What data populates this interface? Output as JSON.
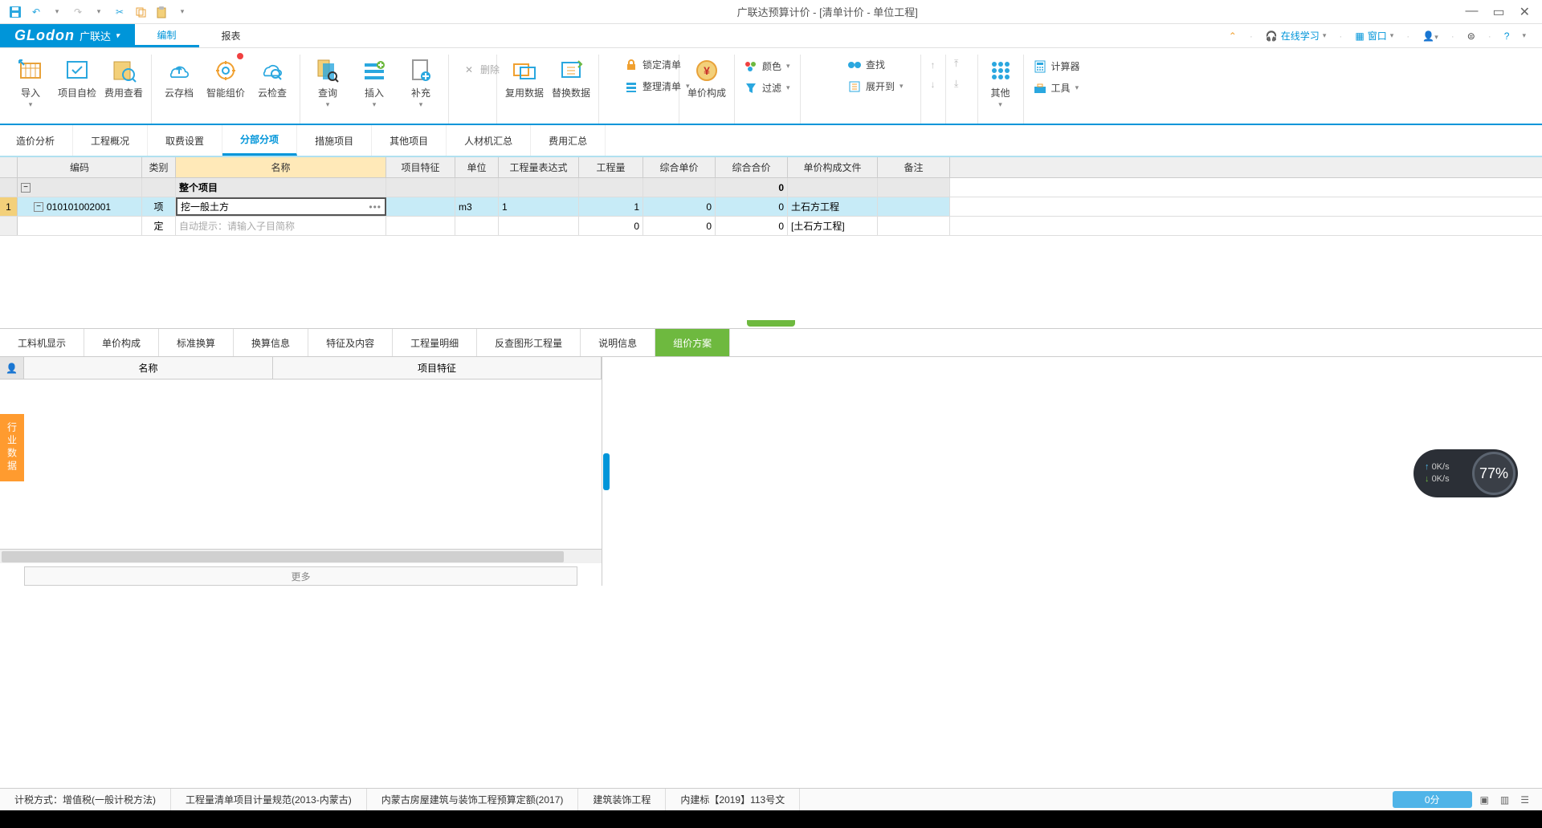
{
  "titlebar": {
    "title": "广联达预算计价 - [清单计价 - 单位工程]"
  },
  "brand": {
    "name": "GLodon",
    "sub": "广联达"
  },
  "menus": {
    "items": [
      "编制",
      "报表"
    ],
    "activeIndex": 0
  },
  "rightmenu": {
    "learn": "在线学习",
    "window": "窗口",
    "help": "?"
  },
  "ribbon": {
    "g1": {
      "import": "导入",
      "selfcheck": "项目自检",
      "feeview": "费用查看"
    },
    "g2": {
      "cloudsave": "云存档",
      "smartprice": "智能组价",
      "cloudcheck": "云检查"
    },
    "g3": {
      "query": "查询",
      "insert": "插入",
      "supplement": "补充",
      "delete": "删除"
    },
    "g4": {
      "copydata": "复用数据",
      "replacedata": "替换数据",
      "lock": "锁定清单",
      "tidy": "整理清单"
    },
    "g5": {
      "unitcomp": "单价构成"
    },
    "g6": {
      "color": "颜色",
      "find": "查找",
      "filter": "过滤",
      "expand": "展开到"
    },
    "g7": {
      "other": "其他"
    },
    "g8": {
      "calc": "计算器",
      "tools": "工具"
    }
  },
  "tabs": {
    "items": [
      "造价分析",
      "工程概况",
      "取费设置",
      "分部分项",
      "措施项目",
      "其他项目",
      "人材机汇总",
      "费用汇总"
    ],
    "activeIndex": 3
  },
  "grid": {
    "headers": {
      "code": "编码",
      "cat": "类别",
      "name": "名称",
      "feat": "项目特征",
      "unit": "单位",
      "expr": "工程量表达式",
      "qty": "工程量",
      "unitprice": "综合单价",
      "totalprice": "综合合价",
      "file": "单价构成文件",
      "remark": "备注"
    },
    "row0": {
      "name": "整个项目",
      "totalprice": "0"
    },
    "row1": {
      "num": "1",
      "code": "010101002001",
      "cat": "项",
      "name": "挖一般土方",
      "unit": "m3",
      "expr": "1",
      "qty": "1",
      "unitprice": "0",
      "totalprice": "0",
      "file": "土石方工程"
    },
    "row2": {
      "cat": "定",
      "placeholder": "自动提示：请输入子目简称",
      "qty": "0",
      "unitprice": "0",
      "totalprice": "0",
      "file": "[土石方工程]"
    }
  },
  "lowertabs": {
    "items": [
      "工料机显示",
      "单价构成",
      "标准换算",
      "换算信息",
      "特征及内容",
      "工程量明细",
      "反查图形工程量",
      "说明信息",
      "组价方案"
    ],
    "activeIndex": 8
  },
  "lowerhead": {
    "name": "名称",
    "feat": "项目特征"
  },
  "more": "更多",
  "sidetab": {
    "label": "行业数据"
  },
  "status": {
    "tax": "计税方式：增值税(一般计税方法)",
    "spec": "工程量清单项目计量规范(2013-内蒙古)",
    "quota": "内蒙古房屋建筑与装饰工程预算定额(2017)",
    "proj": "建筑装饰工程",
    "doc": "内建标【2019】113号文",
    "score": "0分"
  },
  "speed": {
    "up": "0K/s",
    "down": "0K/s",
    "pct": "77%"
  }
}
